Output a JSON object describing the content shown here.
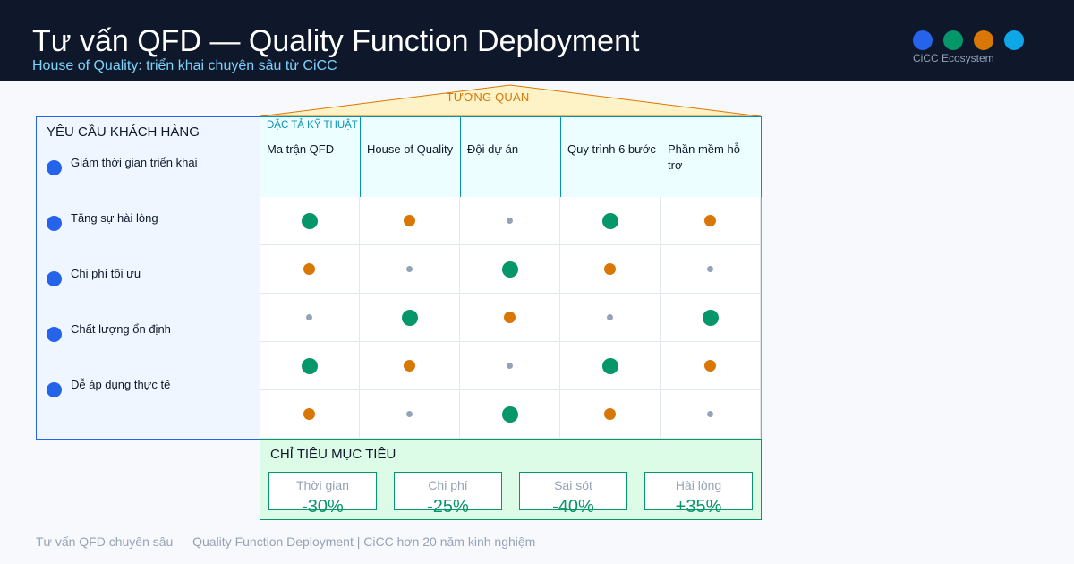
{
  "header": {
    "title": "Tư vấn QFD — Quality Function Deployment",
    "subtitle": "House of Quality: triển khai chuyên sâu từ CiCC",
    "brand": "CiCC Ecosystem",
    "dot_colors": [
      "#2563eb",
      "#059669",
      "#d97706",
      "#0ea5e9"
    ]
  },
  "roof": {
    "label": "TƯƠNG QUAN"
  },
  "requirements": {
    "title": "YÊU CẦU KHÁCH HÀNG",
    "items": [
      "Giảm thời gian triển khai",
      "Tăng sự hài lòng",
      "Chi phí tối ưu",
      "Chất lượng ổn định",
      "Dễ áp dụng thực tế"
    ]
  },
  "specs": {
    "title": "ĐẶC TẢ KỸ THUẬT",
    "columns": [
      "Ma trận QFD",
      "House of Quality",
      "Đội dự án",
      "Quy trình 6 bước",
      "Phần mềm hỗ trợ"
    ]
  },
  "matrix": {
    "rows": [
      [
        "strong",
        "medium",
        "weak",
        "strong",
        "medium"
      ],
      [
        "medium",
        "weak",
        "strong",
        "medium",
        "weak"
      ],
      [
        "weak",
        "strong",
        "medium",
        "weak",
        "strong"
      ],
      [
        "strong",
        "medium",
        "weak",
        "strong",
        "medium"
      ],
      [
        "medium",
        "weak",
        "strong",
        "medium",
        "weak"
      ]
    ],
    "colors": {
      "strong": "#059669",
      "medium": "#d97706",
      "weak": "#94a3b8"
    }
  },
  "targets": {
    "title": "CHỈ TIÊU MỤC TIÊU",
    "items": [
      {
        "label": "Thời gian",
        "value": "-30%"
      },
      {
        "label": "Chi phí",
        "value": "-25%"
      },
      {
        "label": "Sai sót",
        "value": "-40%"
      },
      {
        "label": "Hài lòng",
        "value": "+35%"
      }
    ]
  },
  "footer": "Tư vấn QFD chuyên sâu — Quality Function Deployment | CiCC hơn 20 năm kinh nghiệm"
}
